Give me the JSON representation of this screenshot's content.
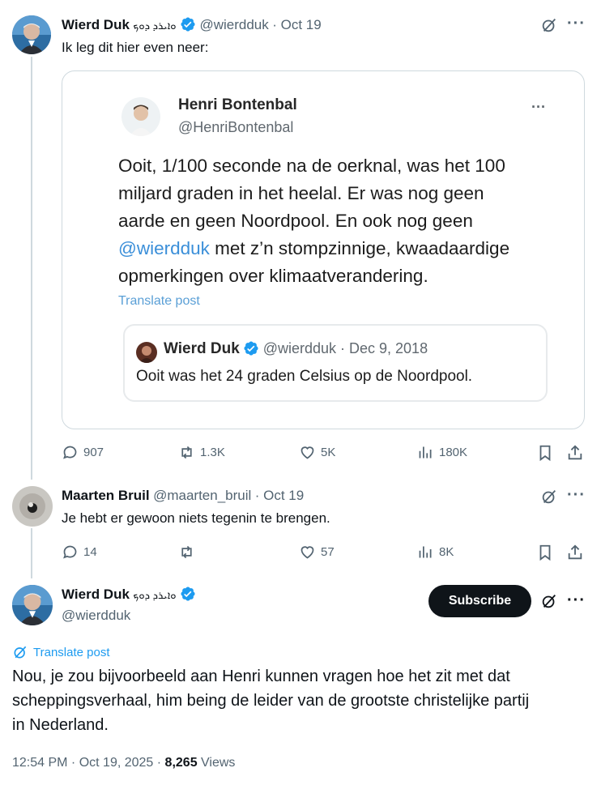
{
  "colors": {
    "accent": "#1d9bf0",
    "text": "#0f1419",
    "muted": "#536471",
    "border": "#cfd9de"
  },
  "tweet1": {
    "name": "Wierd Duk",
    "name_suffix": "ܘܐܝܪܕ ܕܘܟ",
    "handle": "@wierdduk",
    "date": "· Oct 19",
    "text": "Ik leg dit hier even neer:",
    "embed": {
      "name": "Henri Bontenbal",
      "handle": "@HenriBontenbal",
      "body_line1": "Ooit, 1/100 seconde na de oerknal, was het 100",
      "body_line2": "miljard graden in het heelal. Er was nog geen",
      "body_line3": "aarde en geen Noordpool. En ook nog geen",
      "body_mention": "@wierdduk",
      "body_line4_rest": " met z’n stompzinnige, kwaadaardige",
      "body_line5": "opmerkingen over klimaatverandering.",
      "translate": "Translate post",
      "quote_name": "Wierd Duk",
      "quote_handle": "@wierdduk · Dec 9, 2018",
      "quote_text": "Ooit was het 24 graden Celsius op de Noordpool."
    },
    "stats": {
      "replies": "907",
      "reposts": "1.3K",
      "likes": "5K",
      "views": "180K"
    }
  },
  "tweet2": {
    "name": "Maarten Bruil",
    "handle": "@maarten_bruil",
    "date": "· Oct 19",
    "text": "Je hebt er gewoon niets tegenin te brengen.",
    "stats": {
      "replies": "14",
      "reposts": "",
      "likes": "57",
      "views": "8K"
    }
  },
  "main": {
    "name": "Wierd Duk",
    "name_suffix": "ܘܐܝܪܕ ܕܘܟ",
    "handle": "@wierdduk",
    "subscribe": "Subscribe",
    "translate": "Translate post",
    "text_line1": "Nou, je zou bijvoorbeeld aan Henri kunnen vragen hoe het zit met dat",
    "text_line2": "scheppingsverhaal, him being de leider van de grootste christelijke partij",
    "text_line3": "in Nederland.",
    "time": "12:54 PM · Oct 19, 2025 · ",
    "views_count": "8,265",
    "views_label": " Views"
  }
}
